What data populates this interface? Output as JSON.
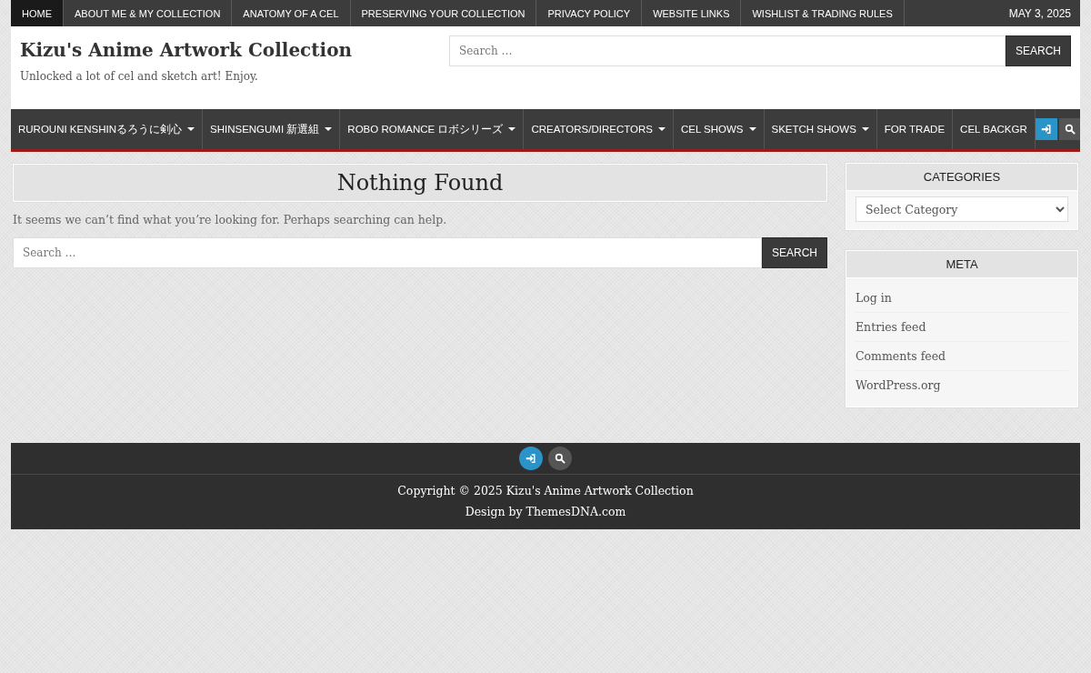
{
  "top_nav": {
    "items": [
      {
        "label": "HOME",
        "selected": true
      },
      {
        "label": "ABOUT ME & MY COLLECTION",
        "selected": false
      },
      {
        "label": "ANATOMY OF A CEL",
        "selected": false
      },
      {
        "label": "PRESERVING YOUR COLLECTION",
        "selected": false
      },
      {
        "label": "PRIVACY POLICY",
        "selected": false
      },
      {
        "label": "WEBSITE LINKS",
        "selected": false
      },
      {
        "label": "WISHLIST & TRADING RULES",
        "selected": false
      }
    ],
    "date": "MAY 3, 2025"
  },
  "header": {
    "site_title": "Kizu's Anime Artwork Collection",
    "tagline": "Unlocked a lot of cel and sketch art! Enjoy.",
    "search": {
      "placeholder": "Search …",
      "button": "SEARCH"
    }
  },
  "main_nav": {
    "items": [
      {
        "label": "RUROUNI KENSHINるろうに剣心",
        "has_submenu": true
      },
      {
        "label": "SHINSENGUMI 新選組",
        "has_submenu": true
      },
      {
        "label": "ROBO ROMANCE ロボシリーズ",
        "has_submenu": true
      },
      {
        "label": "CREATORS/DIRECTORS",
        "has_submenu": true
      },
      {
        "label": "CEL SHOWS",
        "has_submenu": true
      },
      {
        "label": "SKETCH SHOWS",
        "has_submenu": true
      },
      {
        "label": "FOR TRADE",
        "has_submenu": false
      },
      {
        "label": "CEL BACKGR",
        "has_submenu": false
      }
    ]
  },
  "content": {
    "title": "Nothing Found",
    "message": "It seems we can’t find what you’re looking for. Perhaps searching can help.",
    "search": {
      "placeholder": "Search …",
      "button": "SEARCH"
    }
  },
  "sidebar": {
    "widgets": [
      {
        "kind": "dropdown",
        "title": "CATEGORIES",
        "value": "Select Category"
      },
      {
        "kind": "links",
        "title": "META",
        "links": [
          "Log in",
          "Entries feed",
          "Comments feed",
          "WordPress.org"
        ]
      }
    ]
  },
  "footer": {
    "copyright": "Copyright © 2025 Kizu's Anime Artwork Collection",
    "credit": "Design by ThemesDNA.com"
  }
}
